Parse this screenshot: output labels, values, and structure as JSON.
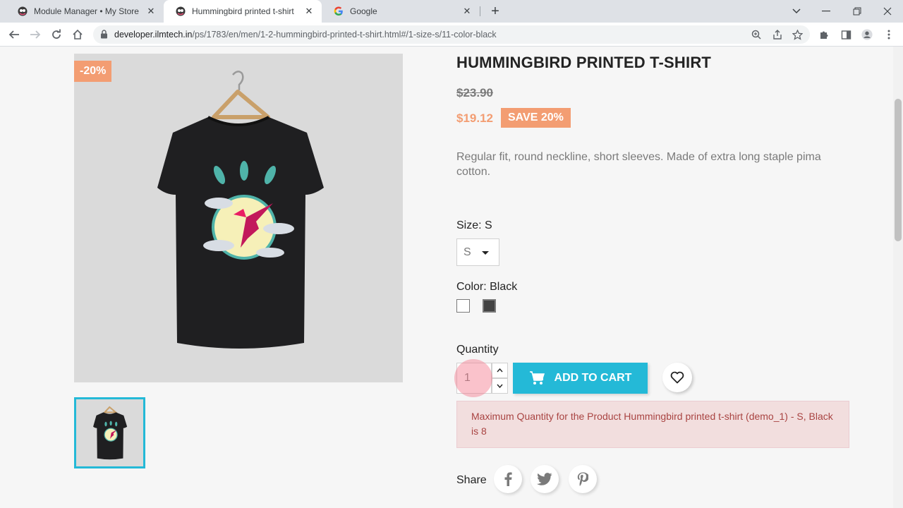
{
  "browser": {
    "tabs": [
      {
        "title": "Module Manager • My Store",
        "active": false
      },
      {
        "title": "Hummingbird printed t-shirt",
        "active": true
      },
      {
        "title": "Google",
        "active": false
      }
    ],
    "url_host": "developer.ilmtech.in",
    "url_path": "/ps/1783/en/men/1-2-hummingbird-printed-t-shirt.html#/1-size-s/11-color-black"
  },
  "product": {
    "discount_flag": "-20%",
    "title": "HUMMINGBIRD PRINTED T-SHIRT",
    "regular_price": "$23.90",
    "price": "$19.12",
    "save_badge": "SAVE 20%",
    "description": "Regular fit, round neckline, short sleeves. Made of extra long staple pima cotton.",
    "size_label": "Size: S",
    "size_selected": "S",
    "color_label": "Color: Black",
    "colors": [
      {
        "name": "White",
        "hex": "#ffffff",
        "selected": false
      },
      {
        "name": "Black",
        "hex": "#434343",
        "selected": true
      }
    ],
    "quantity_label": "Quantity",
    "quantity_value": "1",
    "add_to_cart": "ADD TO CART",
    "alert": "Maximum Quantity for the Product Hummingbird printed t-shirt (demo_1) - S, Black is 8",
    "share_label": "Share"
  },
  "colors": {
    "accent": "#24b9d7",
    "price": "#f39d72",
    "alert_bg": "#f2dede",
    "alert_text": "#a94442"
  },
  "icons": [
    "lock-icon",
    "cart-icon",
    "heart-icon",
    "facebook-icon",
    "twitter-icon",
    "pinterest-icon"
  ]
}
